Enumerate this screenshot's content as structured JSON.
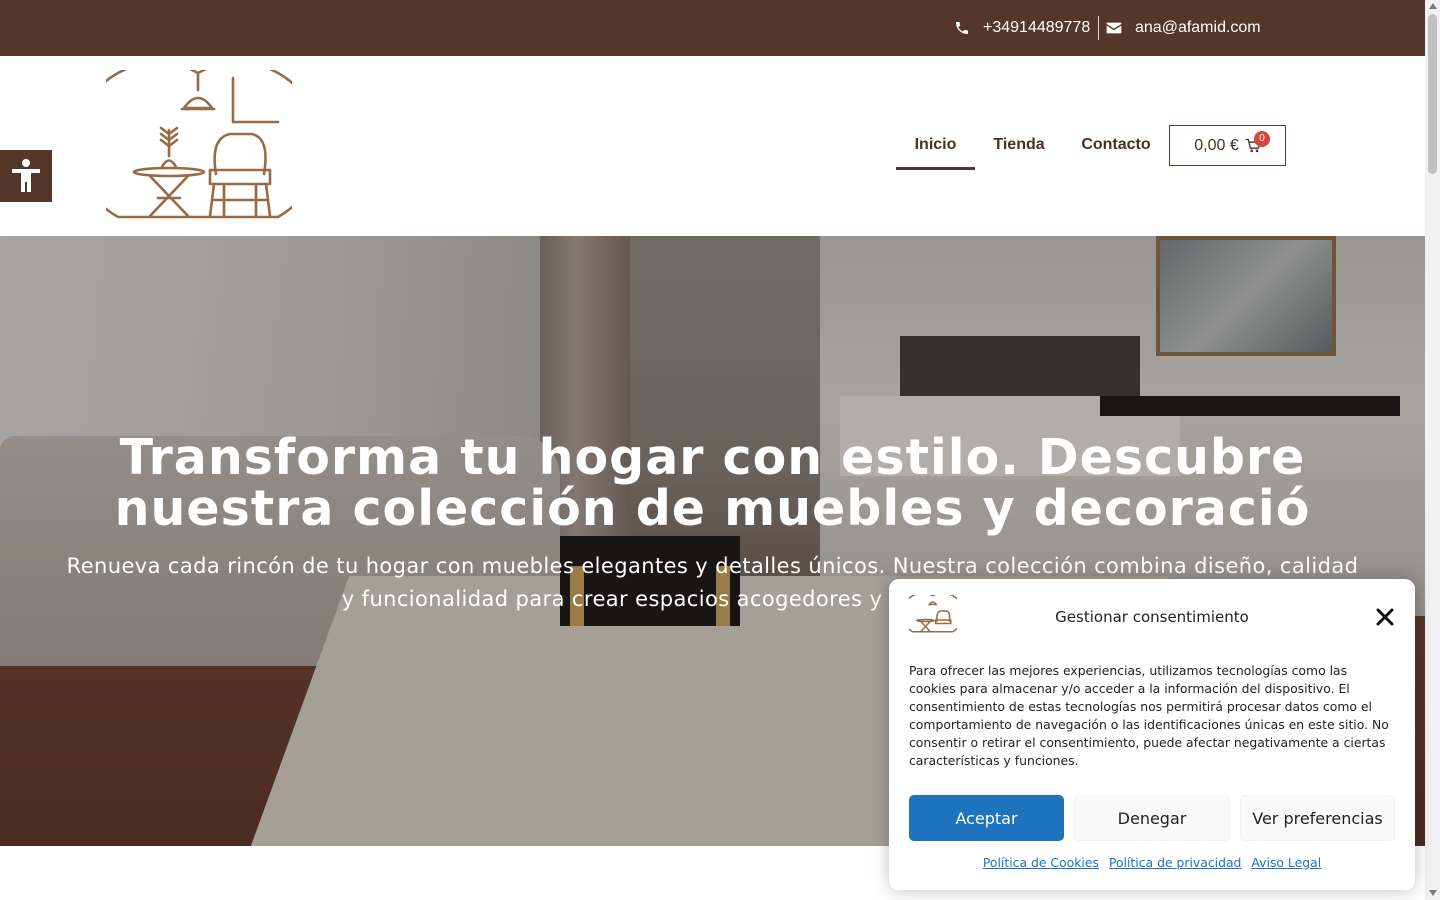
{
  "topbar": {
    "phone": "+34914489778",
    "email": "ana@afamid.com"
  },
  "nav": {
    "items": [
      {
        "label": "Inicio",
        "active": true
      },
      {
        "label": "Tienda",
        "active": false
      },
      {
        "label": "Contacto",
        "active": false
      }
    ],
    "cart_amount": "0,00 €",
    "cart_count": "0"
  },
  "hero": {
    "title_line1": "Transforma tu hogar con estilo. Descubre",
    "title_line2": "nuestra colección de muebles y decoració",
    "subtitle": "Renueva cada rincón de tu hogar con muebles elegantes y detalles únicos. Nuestra colección combina diseño, calidad y funcionalidad para crear espacios acogedores y con personalidad."
  },
  "consent": {
    "title": "Gestionar consentimiento",
    "body": "Para ofrecer las mejores experiencias, utilizamos tecnologías como las cookies para almacenar y/o acceder a la información del dispositivo. El consentimiento de estas tecnologías nos permitirá procesar datos como el comportamiento de navegación o las identificaciones únicas en este sitio. No consentir o retirar el consentimiento, puede afectar negativamente a ciertas características y funciones.",
    "accept_label": "Aceptar",
    "deny_label": "Denegar",
    "prefs_label": "Ver preferencias",
    "links": [
      "Política de Cookies",
      "Política de privacidad",
      "Aviso Legal"
    ]
  },
  "colors": {
    "brand_brown": "#55372a",
    "logo_gold": "#9a6a45",
    "accept_blue": "#1e73be",
    "badge_red": "#d9443b"
  },
  "icons": [
    "phone-icon",
    "envelope-icon",
    "cart-icon",
    "accessibility-icon",
    "close-icon"
  ]
}
